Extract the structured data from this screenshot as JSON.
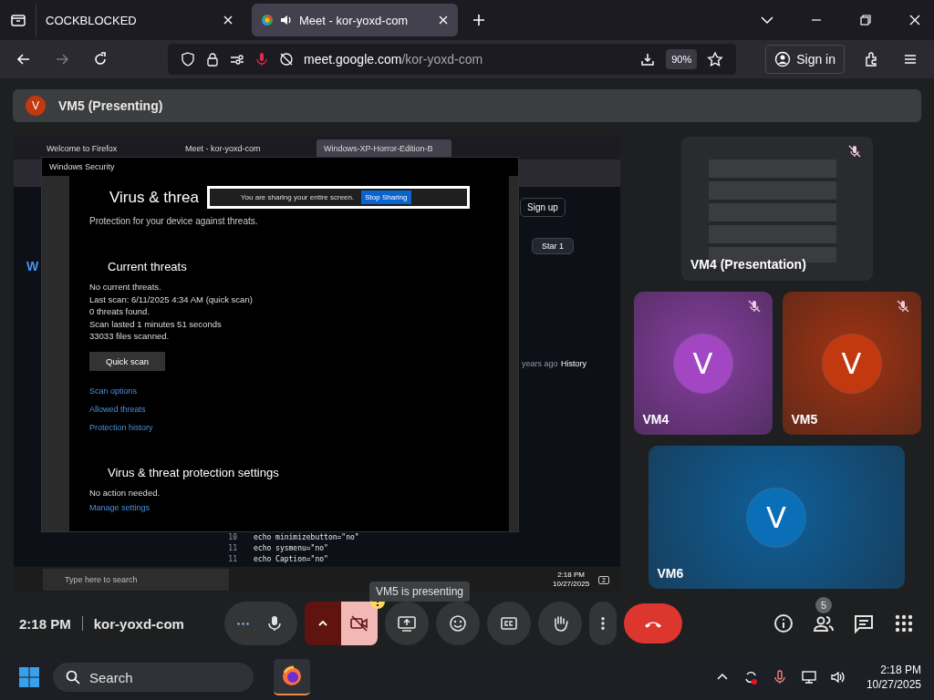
{
  "browser": {
    "tabs": [
      {
        "title": "COCKBLOCKED",
        "selected": false,
        "audio": false
      },
      {
        "title": "Meet - kor-yoxd-com",
        "selected": true,
        "audio": true
      }
    ],
    "url_host": "meet.google.com",
    "url_path": "/kor-yoxd-com",
    "zoom": "90%",
    "sign_in": "Sign in"
  },
  "meet": {
    "presenter_banner": {
      "avatar": "V",
      "label": "VM5 (Presenting)"
    },
    "shared_screen": {
      "tabs": [
        {
          "title": "Welcome to Firefox",
          "selected": false
        },
        {
          "title": "Meet - kor-yoxd-com",
          "selected": false
        },
        {
          "title": "Windows-XP-Horror-Edition-B",
          "selected": true
        }
      ],
      "background_page": {
        "letter": "W",
        "sign_up": "Sign up",
        "star": "Star",
        "star_count": "1",
        "commit_age": "years ago",
        "history": "History",
        "code_lines": [
          {
            "number": "10",
            "code": "echo minimizebutton=\"no\""
          },
          {
            "number": "11",
            "code": "echo sysmenu=\"no\""
          },
          {
            "number": "11",
            "code": "echo Caption=\"no\""
          }
        ]
      },
      "security_window": {
        "title": "Windows Security",
        "heading": "Virus & threa",
        "subtitle": "Protection for your device against threats.",
        "sections": [
          {
            "kind": "threats",
            "heading": "Current threats",
            "lines": [
              "No current threats.",
              "Last scan: 6/11/2025 4:34 AM (quick scan)",
              "0 threats found.",
              "Scan lasted 1 minutes 51 seconds",
              "33033 files scanned."
            ],
            "button": "Quick scan",
            "links": [
              "Scan options",
              "Allowed threats",
              "Protection history"
            ]
          },
          {
            "kind": "settings",
            "heading": "Virus & threat protection settings",
            "lines": [
              "No action needed."
            ],
            "links": [
              "Manage settings"
            ]
          }
        ]
      },
      "sharing_bar": {
        "message": "You are sharing your entire screen.",
        "stop": "Stop Sharing"
      },
      "taskbar": {
        "search_placeholder": "Type here to search",
        "time": "2:18 PM",
        "date": "10/27/2025",
        "notifications": "2"
      }
    },
    "participants": [
      {
        "kind": "presentation",
        "name": "VM4 (Presentation)",
        "muted": true
      },
      {
        "kind": "tile",
        "name": "VM4",
        "avatar": "V",
        "color": "#a346c4",
        "muted": true
      },
      {
        "kind": "tile",
        "name": "VM5",
        "avatar": "V",
        "color": "#c2380f",
        "muted": true
      },
      {
        "kind": "wide",
        "name": "VM6",
        "avatar": "V",
        "color": "#0b6fb8",
        "muted": false
      }
    ],
    "tooltip": "VM5 is presenting",
    "meeting_time": "2:18 PM",
    "meeting_code": "kor-yoxd-com",
    "controls": [
      {
        "kind": "mic",
        "on": true
      },
      {
        "kind": "camera",
        "on": false,
        "warning": true
      },
      {
        "kind": "present"
      },
      {
        "kind": "reactions"
      },
      {
        "kind": "captions",
        "on": false
      },
      {
        "kind": "hand",
        "on": false
      },
      {
        "kind": "more"
      },
      {
        "kind": "leave"
      }
    ],
    "side_buttons": [
      {
        "kind": "info"
      },
      {
        "kind": "people",
        "badge": "5"
      },
      {
        "kind": "chat"
      },
      {
        "kind": "apps"
      }
    ]
  },
  "taskbar": {
    "search_placeholder": "Search",
    "time": "2:18 PM",
    "date": "10/27/2025"
  }
}
